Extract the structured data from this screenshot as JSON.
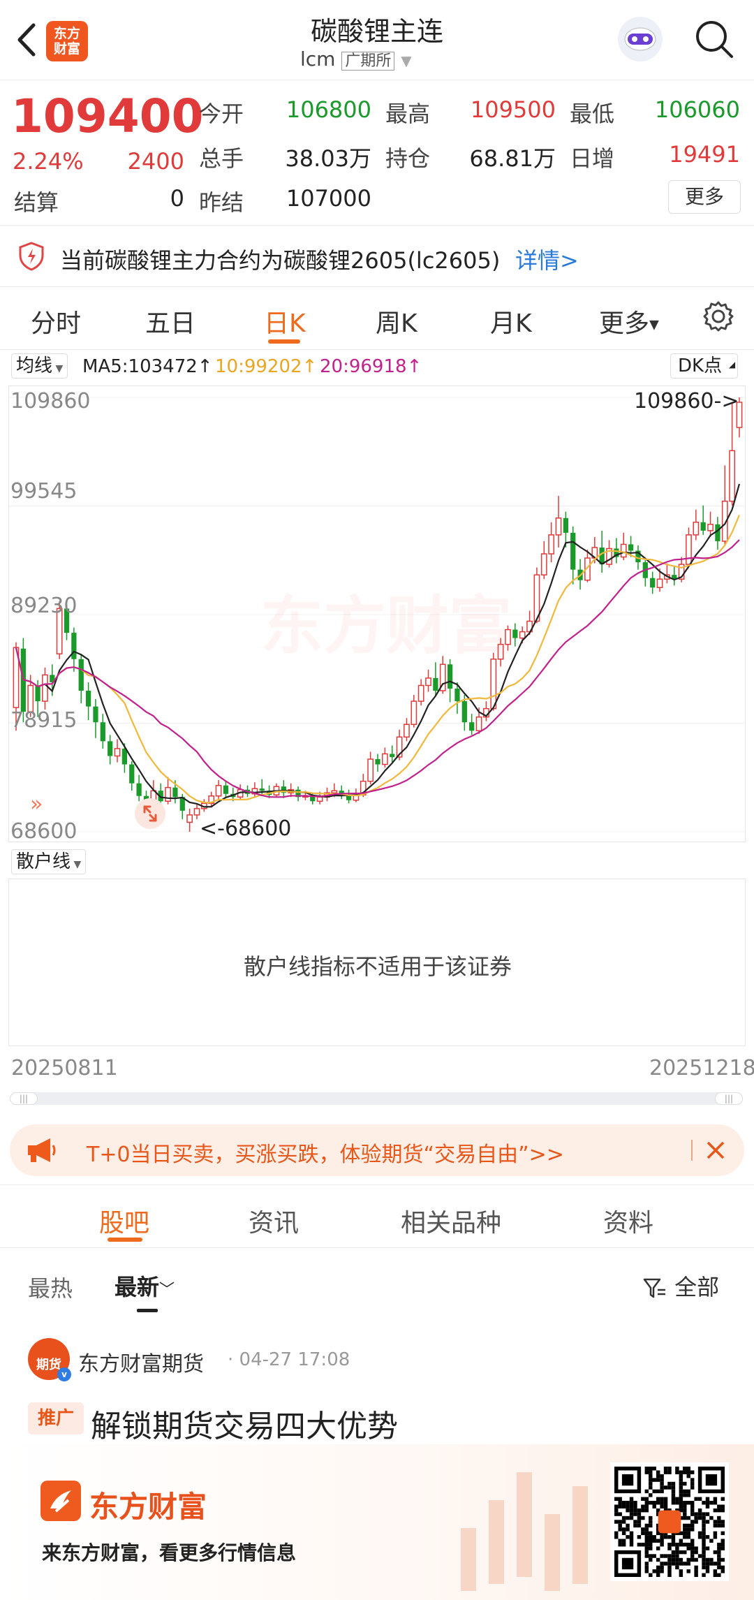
{
  "header": {
    "title": "碳酸锂主连",
    "code": "lcm",
    "exchange": "广期所",
    "logo_text": "东方财富"
  },
  "quote": {
    "price": "109400",
    "pct": "2.24%",
    "change": "2400",
    "open_label": "今开",
    "open": "106800",
    "high_label": "最高",
    "high": "109500",
    "low_label": "最低",
    "low": "106060",
    "volume_label": "总手",
    "volume": "38.03万",
    "oi_label": "持仓",
    "oi": "68.81万",
    "daily_inc_label": "日增",
    "daily_inc": "19491",
    "settle_label": "结算",
    "settle": "0",
    "prev_settle_label": "昨结",
    "prev_settle": "107000",
    "more": "更多"
  },
  "notice": {
    "text": "当前碳酸锂主力合约为碳酸锂2605(lc2605)",
    "link": "详情>"
  },
  "period_tabs": [
    "分时",
    "五日",
    "日K",
    "周K",
    "月K",
    "更多"
  ],
  "period_active": 2,
  "ma_bar": {
    "selector": "均线",
    "ma5": "MA5:103472",
    "ma10": "10:99202",
    "ma20": "20:96918",
    "dk": "DK点"
  },
  "y_labels": [
    "109860",
    "99545",
    "89230",
    "78915",
    "68600"
  ],
  "marks": {
    "high": "109860->",
    "low": "<-68600"
  },
  "watermark": "东方财富",
  "indicator": {
    "selector": "散户线",
    "message": "散户线指标不适用于该证券"
  },
  "dates": {
    "start": "20250811",
    "end": "20251218"
  },
  "promo": {
    "text": "T+0当日买卖，买涨买跌，体验期货“交易自由”>>"
  },
  "section_tabs": [
    "股吧",
    "资讯",
    "相关品种",
    "资料"
  ],
  "section_active": 0,
  "sort": {
    "hot": "最热",
    "new": "最新",
    "filter": "全部"
  },
  "post": {
    "author": "东方财富期货",
    "avatar_text": "期货",
    "time": "· 04-27 17:08",
    "tag": "推广",
    "title": "解锁期货交易四大优势"
  },
  "footer": {
    "brand": "东方财富",
    "slogan": "来东方财富，看更多行情信息"
  },
  "colors": {
    "up": "#e13a3a",
    "down": "#1a9a2a",
    "accent": "#ee6a1c",
    "ma5": "#222222",
    "ma10": "#f0b83c",
    "ma20": "#c0218c"
  },
  "chart_data": {
    "type": "candlestick",
    "ylim": [
      68600,
      109860
    ],
    "x_range": [
      "20250811",
      "20251218"
    ],
    "candles": [
      [
        80400,
        86100,
        78200,
        86600
      ],
      [
        86000,
        80000,
        79000,
        87000
      ],
      [
        80000,
        82500,
        79500,
        83500
      ],
      [
        82500,
        81000,
        79500,
        83000
      ],
      [
        81000,
        83500,
        80200,
        84200
      ],
      [
        83500,
        82800,
        81500,
        84500
      ],
      [
        85500,
        89800,
        85000,
        90500
      ],
      [
        89800,
        87500,
        86800,
        90200
      ],
      [
        87500,
        85000,
        83800,
        88000
      ],
      [
        85000,
        82000,
        80800,
        85500
      ],
      [
        82000,
        80500,
        79200,
        82800
      ],
      [
        80500,
        79000,
        77500,
        81200
      ],
      [
        79000,
        77200,
        76500,
        79800
      ],
      [
        77200,
        75800,
        75000,
        77800
      ],
      [
        75800,
        76500,
        75200,
        77400
      ],
      [
        76500,
        75000,
        74200,
        77000
      ],
      [
        75000,
        73200,
        72500,
        75300
      ],
      [
        73200,
        72000,
        71500,
        74000
      ],
      [
        72000,
        70200,
        69500,
        72500
      ],
      [
        70200,
        72500,
        70000,
        73500
      ],
      [
        72500,
        71500,
        71000,
        73200
      ],
      [
        71500,
        72800,
        71200,
        73800
      ],
      [
        72800,
        71900,
        71300,
        73500
      ],
      [
        71900,
        70600,
        69800,
        72200
      ],
      [
        69500,
        70200,
        68600,
        70800
      ],
      [
        70200,
        70800,
        69800,
        71200
      ],
      [
        70800,
        71300,
        70500,
        71700
      ],
      [
        71300,
        72000,
        70900,
        72400
      ],
      [
        72000,
        73000,
        71700,
        73500
      ],
      [
        73000,
        72200,
        71800,
        73400
      ],
      [
        72200,
        71900,
        71500,
        72800
      ],
      [
        71900,
        72600,
        71600,
        73100
      ],
      [
        72600,
        72200,
        71900,
        73000
      ],
      [
        72200,
        72700,
        71900,
        73300
      ],
      [
        72700,
        72500,
        72000,
        73600
      ],
      [
        72500,
        72100,
        71800,
        73000
      ],
      [
        72100,
        72900,
        71900,
        73200
      ],
      [
        72900,
        72300,
        71800,
        73500
      ],
      [
        72300,
        72600,
        71900,
        73200
      ],
      [
        72600,
        71900,
        71500,
        72900
      ],
      [
        71900,
        72000,
        71600,
        72500
      ],
      [
        72000,
        71500,
        71200,
        72300
      ],
      [
        71500,
        71900,
        71200,
        72400
      ],
      [
        71900,
        72300,
        71500,
        72800
      ],
      [
        72300,
        72500,
        71900,
        73200
      ],
      [
        72500,
        72000,
        71700,
        73000
      ],
      [
        72000,
        71600,
        71300,
        72600
      ],
      [
        71600,
        72100,
        71400,
        72700
      ],
      [
        72100,
        73400,
        71900,
        74100
      ],
      [
        73400,
        75500,
        73100,
        76200
      ],
      [
        75500,
        75000,
        74300,
        76000
      ],
      [
        75000,
        76000,
        74700,
        76600
      ],
      [
        76000,
        75700,
        75200,
        76800
      ],
      [
        75700,
        77600,
        75400,
        78300
      ],
      [
        77600,
        78800,
        77200,
        79400
      ],
      [
        78800,
        81000,
        78500,
        81600
      ],
      [
        81000,
        82500,
        80600,
        83100
      ],
      [
        82500,
        83200,
        81900,
        84000
      ],
      [
        83200,
        82000,
        81500,
        84700
      ],
      [
        82000,
        84500,
        81700,
        85300
      ],
      [
        84500,
        82200,
        80900,
        85000
      ],
      [
        82200,
        81000,
        79800,
        82800
      ],
      [
        81000,
        79000,
        78200,
        81600
      ],
      [
        79000,
        78200,
        77800,
        79800
      ],
      [
        78200,
        79500,
        77900,
        80400
      ],
      [
        79500,
        80300,
        79100,
        81000
      ],
      [
        80300,
        85000,
        80100,
        85600
      ],
      [
        85000,
        86400,
        84300,
        87000
      ],
      [
        86400,
        87800,
        85800,
        88200
      ],
      [
        87800,
        87000,
        86200,
        88400
      ],
      [
        87000,
        87600,
        86500,
        88100
      ],
      [
        87600,
        88600,
        87300,
        89600
      ],
      [
        88600,
        93000,
        88400,
        93700
      ],
      [
        93000,
        95000,
        92600,
        96200
      ],
      [
        95000,
        96800,
        94200,
        98000
      ],
      [
        96800,
        98400,
        95600,
        100500
      ],
      [
        98400,
        97000,
        95600,
        99000
      ],
      [
        97000,
        93500,
        92100,
        97600
      ],
      [
        93500,
        92500,
        91600,
        94500
      ],
      [
        92500,
        94600,
        92300,
        95400
      ],
      [
        94600,
        95600,
        94100,
        96600
      ],
      [
        95600,
        94000,
        93200,
        97200
      ],
      [
        94000,
        95500,
        93700,
        96300
      ],
      [
        95500,
        94700,
        94100,
        96500
      ],
      [
        94700,
        95900,
        94400,
        97000
      ],
      [
        95900,
        95300,
        94700,
        96700
      ],
      [
        95300,
        94200,
        93500,
        95800
      ],
      [
        94200,
        92700,
        91900,
        94400
      ],
      [
        92700,
        91800,
        91200,
        93300
      ],
      [
        91800,
        92600,
        91400,
        93600
      ],
      [
        92600,
        93000,
        92200,
        94100
      ],
      [
        93000,
        92600,
        92000,
        93800
      ],
      [
        92600,
        94000,
        92300,
        94700
      ],
      [
        94000,
        96800,
        93800,
        97500
      ],
      [
        96800,
        98000,
        96300,
        99200
      ],
      [
        98000,
        97200,
        96800,
        99600
      ],
      [
        97200,
        97800,
        96600,
        99000
      ],
      [
        97800,
        96200,
        95400,
        98500
      ],
      [
        96200,
        100000,
        95900,
        103400
      ],
      [
        100000,
        104800,
        99600,
        109300
      ],
      [
        107000,
        109400,
        106060,
        109860
      ]
    ]
  }
}
